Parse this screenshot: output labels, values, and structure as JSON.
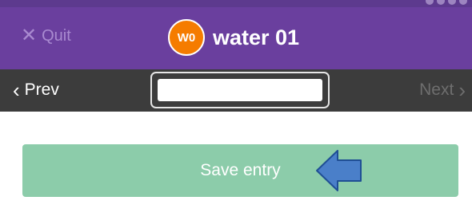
{
  "header": {
    "quit_label": "Quit",
    "avatar_initials": "W0",
    "title": "water 01"
  },
  "navbar": {
    "prev_label": "Prev",
    "next_label": "Next",
    "entry_value": ""
  },
  "main": {
    "save_label": "Save entry"
  },
  "colors": {
    "header_bg": "#6a3f9e",
    "navbar_bg": "#3c3c3c",
    "avatar_bg": "#f57c00",
    "save_button_bg": "#8cccaa",
    "arrow_fill": "#4a7fc9"
  },
  "icons": {
    "quit": "close-icon",
    "prev": "chevron-left-icon",
    "next": "chevron-right-icon",
    "annotation": "left-arrow-icon"
  }
}
